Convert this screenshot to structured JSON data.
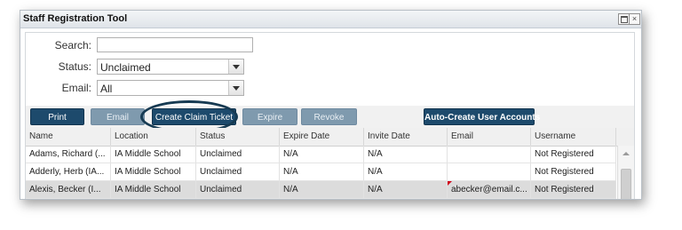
{
  "window": {
    "title": "Staff Registration Tool",
    "max_button": "",
    "close_button": "×"
  },
  "filters": {
    "search_label": "Search:",
    "search_value": "",
    "status_label": "Status:",
    "status_value": "Unclaimed",
    "email_label": "Email:",
    "email_value": "All"
  },
  "toolbar": {
    "print": "Print",
    "email": "Email",
    "create_claim_ticket": "Create Claim Ticket",
    "expire": "Expire",
    "revoke": "Revoke",
    "auto_create": "Auto-Create User Accounts"
  },
  "grid": {
    "columns": [
      "Name",
      "Location",
      "Status",
      "Expire Date",
      "Invite Date",
      "Email",
      "Username"
    ],
    "rows": [
      [
        "Adams, Richard (...",
        "IA Middle School",
        "Unclaimed",
        "N/A",
        "N/A",
        "",
        "Not Registered"
      ],
      [
        "Adderly, Herb (IA...",
        "IA Middle School",
        "Unclaimed",
        "N/A",
        "N/A",
        "",
        "Not Registered"
      ],
      [
        "Alexis, Becker (I...",
        "IA Middle School",
        "Unclaimed",
        "N/A",
        "N/A",
        "abecker@email.c...",
        "Not Registered"
      ]
    ],
    "selected_row": 2
  },
  "colors": {
    "dark_button": "#1d4a6c",
    "disabled_button": "#7f9aae",
    "highlight_ring": "#163a52",
    "dirty_marker": "#d0021b"
  }
}
